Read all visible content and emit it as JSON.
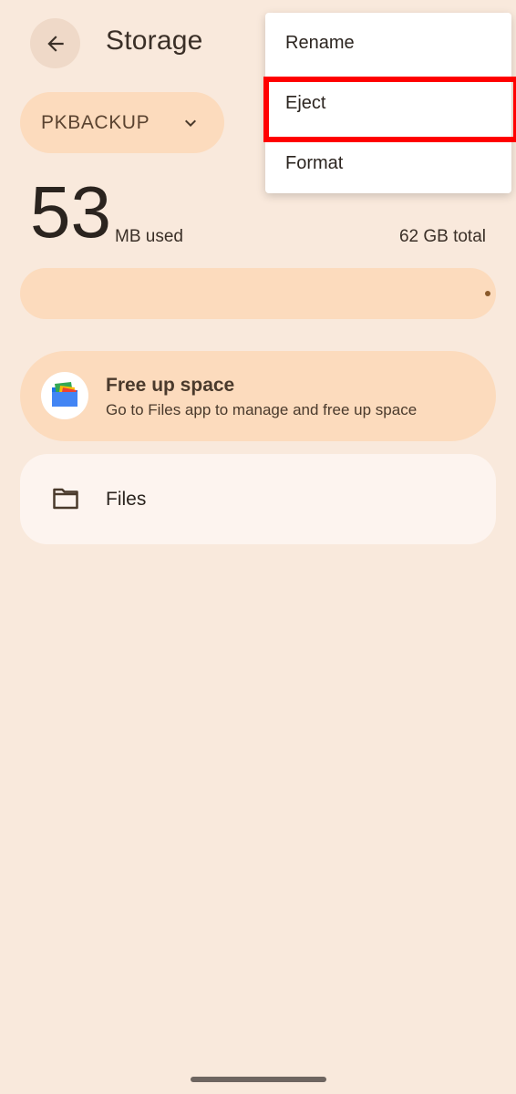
{
  "header": {
    "title": "Storage"
  },
  "device": {
    "name": "PKBACKUP"
  },
  "usage": {
    "used_value": "53",
    "used_unit": "MB used",
    "total": "62 GB total",
    "used_fraction": 0.001
  },
  "cards": {
    "free_up": {
      "title": "Free up space",
      "subtitle": "Go to Files app to manage and free up space"
    },
    "files": {
      "label": "Files"
    }
  },
  "menu": {
    "items": [
      {
        "label": "Rename"
      },
      {
        "label": "Eject"
      },
      {
        "label": "Format"
      }
    ]
  },
  "icons": {
    "back": "arrow-back-icon",
    "chevron": "chevron-down-icon",
    "files_app": "files-app-icon",
    "folder": "folder-icon"
  },
  "colors": {
    "background": "#f9e9dc",
    "accent_container": "#fcdbbd",
    "usage_fill": "#8a5a2b",
    "highlight": "#ff0000"
  }
}
